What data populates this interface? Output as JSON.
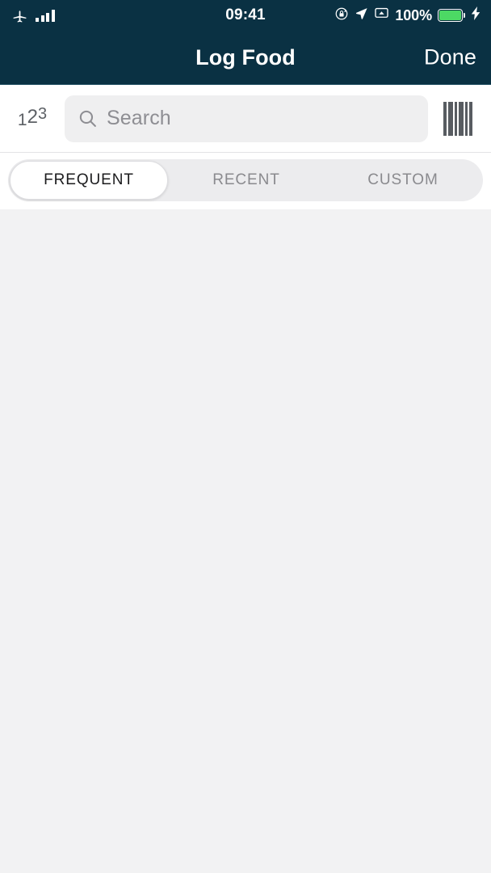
{
  "status_bar": {
    "airplane_icon": "airplane-mode-icon",
    "signal_icon": "cellular-signal-icon",
    "time": "09:41",
    "rotation_lock_icon": "rotation-lock-icon",
    "location_icon": "location-arrow-icon",
    "airplay_icon": "screen-mirroring-icon",
    "battery_percent": "100%",
    "battery_icon": "battery-full-icon",
    "charging_icon": "charging-bolt-icon",
    "background_color": "#0a3143"
  },
  "navbar": {
    "title": "Log Food",
    "done_label": "Done",
    "background_color": "#0a3143",
    "text_color": "#ffffff"
  },
  "search_row": {
    "numeric_icon_digits": [
      "1",
      "2",
      "3"
    ],
    "search_icon": "search-magnifier-icon",
    "placeholder": "Search",
    "value": "",
    "barcode_icon": "barcode-scanner-icon",
    "field_background": "#efeff0"
  },
  "segmented_control": {
    "selected_index": 0,
    "tabs": [
      {
        "label": "FREQUENT",
        "selected": true
      },
      {
        "label": "RECENT",
        "selected": false
      },
      {
        "label": "CUSTOM",
        "selected": false
      }
    ],
    "track_color": "#ececee",
    "active_color": "#ffffff"
  },
  "content": {
    "items": [],
    "background_color": "#f2f2f3"
  }
}
